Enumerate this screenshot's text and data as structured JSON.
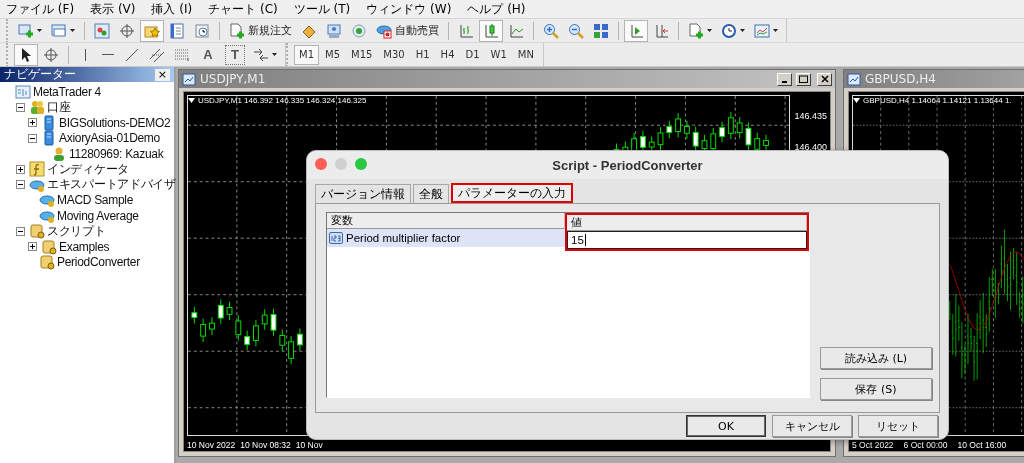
{
  "menu": [
    "ファイル (F)",
    "表示 (V)",
    "挿入 (I)",
    "チャート (C)",
    "ツール (T)",
    "ウィンドウ (W)",
    "ヘルプ (H)"
  ],
  "toolbar": [
    {
      "selected": false
    },
    {
      "selected": false
    },
    {
      "selected": false
    },
    {
      "selected": false
    },
    {
      "selected": true
    },
    {
      "selected": false
    },
    {
      "selected": false
    },
    {
      "label": "新規注文",
      "selected": false
    },
    {
      "selected": false
    },
    {
      "selected": false
    },
    {
      "selected": false
    },
    {
      "label": "自動売買",
      "selected": false
    },
    {
      "selected": false
    },
    {
      "selected": true
    },
    {
      "selected": false
    },
    {
      "selected": false
    },
    {
      "selected": false
    },
    {
      "selected": false
    },
    {
      "selected": true
    },
    {
      "selected": false
    },
    {
      "selected": false
    },
    {
      "selected": false
    },
    {
      "selected": false
    }
  ],
  "tools": [
    {
      "selected": true
    },
    {
      "selected": false
    },
    {
      "selected": false
    },
    {
      "selected": false
    },
    {
      "selected": false
    },
    {
      "selected": false
    },
    {
      "selected": false
    },
    {
      "label": "A",
      "selected": false
    },
    {
      "label": "T",
      "selected": false
    },
    {
      "selected": false
    }
  ],
  "timeframes": [
    {
      "label": "M1",
      "selected": true
    },
    {
      "label": "M5",
      "selected": false
    },
    {
      "label": "M15",
      "selected": false
    },
    {
      "label": "M30",
      "selected": false
    },
    {
      "label": "H1",
      "selected": false
    },
    {
      "label": "H4",
      "selected": false
    },
    {
      "label": "D1",
      "selected": false
    },
    {
      "label": "W1",
      "selected": false
    },
    {
      "label": "MN",
      "selected": false
    }
  ],
  "navigator": {
    "title": "ナビゲーター",
    "close": "×",
    "tree": [
      {
        "label": "MetaTrader 4",
        "kind": "root",
        "children": [
          {
            "label": "口座",
            "kind": "accounts",
            "expanded": true,
            "children": [
              {
                "label": "BIGSolutions-DEMO2",
                "kind": "server",
                "expanded": false
              },
              {
                "label": "AxioryAsia-01Demo",
                "kind": "server",
                "expanded": true,
                "children": [
                  {
                    "label": "11280969: Kazuak",
                    "kind": "user"
                  }
                ]
              }
            ]
          },
          {
            "label": "インディケータ",
            "kind": "indicators",
            "expanded": false
          },
          {
            "label": "エキスパートアドバイザ",
            "kind": "experts",
            "expanded": true,
            "children": [
              {
                "label": "MACD Sample",
                "kind": "expert"
              },
              {
                "label": "Moving Average",
                "kind": "expert"
              }
            ]
          },
          {
            "label": "スクリプト",
            "kind": "scripts",
            "expanded": true,
            "children": [
              {
                "label": "Examples",
                "kind": "script",
                "expanded": false
              },
              {
                "label": "PeriodConverter",
                "kind": "script"
              }
            ]
          }
        ]
      }
    ]
  },
  "charts": [
    {
      "title": "USDJPY,M1",
      "kind": "candles",
      "controls": true,
      "info": "USDJPY,M1  146.392 146.335 146.324 146.325",
      "prices": [
        "146.435",
        "146.400"
      ],
      "times": [
        "10 Nov 2022",
        "10 Nov 08:32",
        "10 Nov"
      ]
    },
    {
      "title": "GBPUSD,H4",
      "kind": "bars",
      "info": "GBPUSD,H4  1.14064 1.14121 1.13644 1.",
      "times": [
        "5 Oct 2022",
        "6 Oct 00:00",
        "10 Oct 16:00"
      ]
    }
  ],
  "dialog": {
    "title": "Script - PeriodConverter",
    "tabs": [
      {
        "label": "バージョン情報",
        "selected": false,
        "highlighted": false
      },
      {
        "label": "全般",
        "selected": false,
        "highlighted": false
      },
      {
        "label": "パラメーターの入力",
        "selected": true,
        "highlighted": true
      }
    ],
    "columns": [
      {
        "label": "変数",
        "highlighted": false
      },
      {
        "label": "値",
        "highlighted": true
      }
    ],
    "rows": [
      {
        "name": "Period multiplier factor",
        "value": "15",
        "selected": true
      }
    ],
    "side_buttons": [
      "読み込み (L)",
      "保存 (S)"
    ],
    "buttons": [
      {
        "label": "OK",
        "default": true
      },
      {
        "label": "キャンセル",
        "default": false
      },
      {
        "label": "リセット",
        "default": false
      }
    ]
  }
}
